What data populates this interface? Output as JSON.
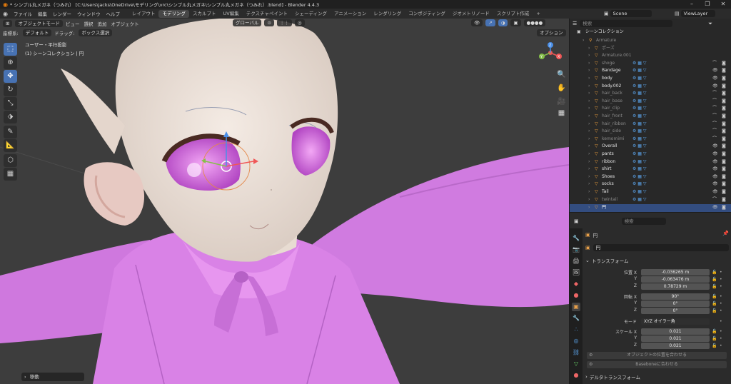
{
  "titlebar": {
    "title": "* シンプル丸メガネ（つみれ） [C:\\Users\\jacks\\OneDrive\\モデリング\\vrc\\シンプル丸メガネ\\シンプル丸メガネ（つみれ）.blend] - Blender 4.4.3"
  },
  "menus": [
    "ファイル",
    "編集",
    "レンダー",
    "ウィンドウ",
    "ヘルプ"
  ],
  "workspaces": [
    {
      "label": "レイアウト",
      "active": false
    },
    {
      "label": "モデリング",
      "active": true
    },
    {
      "label": "スカルプト",
      "active": false
    },
    {
      "label": "UV編集",
      "active": false
    },
    {
      "label": "テクスチャペイント",
      "active": false
    },
    {
      "label": "シェーディング",
      "active": false
    },
    {
      "label": "アニメーション",
      "active": false
    },
    {
      "label": "レンダリング",
      "active": false
    },
    {
      "label": "コンポジティング",
      "active": false
    },
    {
      "label": "ジオメトリノード",
      "active": false
    },
    {
      "label": "スクリプト作成",
      "active": false
    }
  ],
  "add_workspace": "+",
  "scene": {
    "label": "Scene"
  },
  "view_layer": {
    "label": "ViewLayer"
  },
  "viewport": {
    "mode": "オブジェクトモード",
    "view": "ビュー",
    "select": "選択",
    "add": "追加",
    "object": "オブジェクト",
    "transform_orientation": "グローバル",
    "coord_label": "座標系:",
    "coord_value": "デフォルト",
    "drag_label": "ドラッグ:",
    "drag_value": "ボックス選択",
    "options": "オプション",
    "overlay_title": "ユーザー・平行投影",
    "overlay_subtitle": "(1) シーンコレクション | 円",
    "last_op": "移動",
    "gizmo_axes": {
      "x": "X",
      "y": "Y",
      "z": "Z"
    }
  },
  "outliner": {
    "search_placeholder": "検索",
    "root": "シーンコレクション",
    "rows": [
      {
        "name": "Armature",
        "level": 0,
        "bright": false
      },
      {
        "name": "ポーズ",
        "level": 1,
        "bright": false
      },
      {
        "name": "Armature.001",
        "level": 1,
        "bright": false
      },
      {
        "name": "shoge",
        "level": 1,
        "bright": false
      },
      {
        "name": "Bandage",
        "level": 1,
        "bright": true
      },
      {
        "name": "body",
        "level": 1,
        "bright": true
      },
      {
        "name": "body.002",
        "level": 1,
        "bright": true
      },
      {
        "name": "hair_back",
        "level": 1,
        "bright": false
      },
      {
        "name": "hair_base",
        "level": 1,
        "bright": false
      },
      {
        "name": "hair_clip",
        "level": 1,
        "bright": false
      },
      {
        "name": "hair_front",
        "level": 1,
        "bright": false
      },
      {
        "name": "hair_ribbon",
        "level": 1,
        "bright": false
      },
      {
        "name": "hair_side",
        "level": 1,
        "bright": false
      },
      {
        "name": "kemomimi",
        "level": 1,
        "bright": false
      },
      {
        "name": "Overall",
        "level": 1,
        "bright": true
      },
      {
        "name": "pants",
        "level": 1,
        "bright": true
      },
      {
        "name": "ribbon",
        "level": 1,
        "bright": true
      },
      {
        "name": "shirt",
        "level": 1,
        "bright": true
      },
      {
        "name": "Shoes",
        "level": 1,
        "bright": true
      },
      {
        "name": "socks",
        "level": 1,
        "bright": true
      },
      {
        "name": "Tail",
        "level": 1,
        "bright": true
      },
      {
        "name": "twintail",
        "level": 1,
        "bright": false
      }
    ],
    "selected_row": "円"
  },
  "properties": {
    "search_placeholder": "検索",
    "object_name": "円",
    "object_name_field": "円",
    "transform_title": "トランスフォーム",
    "location_label": "位置 X",
    "location": {
      "x": "-0.036265 m",
      "y": "-0.063476 m",
      "z": "0.78729 m"
    },
    "rotation_label": "回転 X",
    "rotation": {
      "x": "90°",
      "y": "0°",
      "z": "0°"
    },
    "mode_label": "モード",
    "mode_value": "XYZ オイラー角",
    "scale_label": "スケール X",
    "scale": {
      "x": "0.021",
      "y": "0.021",
      "z": "0.021"
    },
    "btn_fit_object": "オブジェクトの位置を合わせる",
    "btn_fit_bone": "Baseboneに合わせる",
    "delta_title": "デルタトランスフォーム",
    "y_label": "Y",
    "z_label": "Z"
  },
  "colors": {
    "accent_blue": "#4772b3",
    "outfit_pink": "#d27de0",
    "skin": "#efe3da",
    "selection_row": "#334d80"
  }
}
